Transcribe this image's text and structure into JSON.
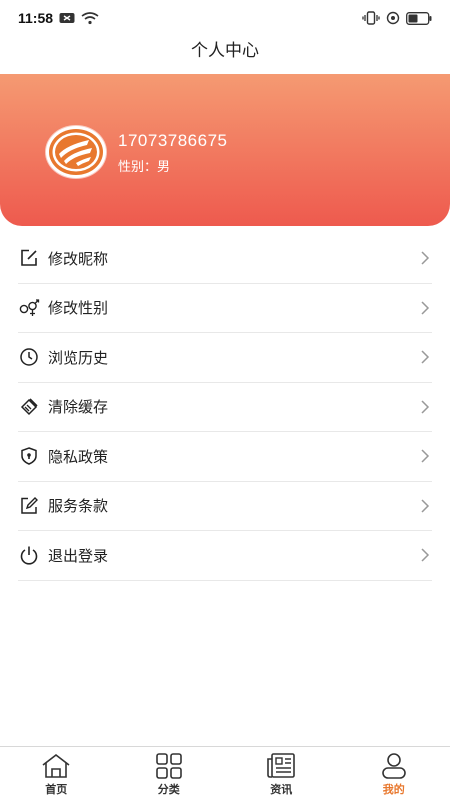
{
  "status_bar": {
    "time": "11:58"
  },
  "header": {
    "title": "个人中心"
  },
  "profile": {
    "phone": "17073786675",
    "gender_label": "性别：",
    "gender_value": "男"
  },
  "menu": [
    {
      "label": "修改昵称",
      "icon": "edit-icon"
    },
    {
      "label": "修改性别",
      "icon": "gender-icon"
    },
    {
      "label": "浏览历史",
      "icon": "clock-icon"
    },
    {
      "label": "清除缓存",
      "icon": "broom-icon"
    },
    {
      "label": "隐私政策",
      "icon": "shield-icon"
    },
    {
      "label": "服务条款",
      "icon": "pen-note-icon"
    },
    {
      "label": "退出登录",
      "icon": "power-icon"
    }
  ],
  "tabbar": [
    {
      "label": "首页",
      "icon": "home-icon"
    },
    {
      "label": "分类",
      "icon": "grid-icon"
    },
    {
      "label": "资讯",
      "icon": "news-icon"
    },
    {
      "label": "我的",
      "icon": "user-icon",
      "active": true
    }
  ],
  "colors": {
    "accent": "#e8782e",
    "gradient_top": "#f59a72",
    "gradient_bottom": "#ee5a4e"
  }
}
